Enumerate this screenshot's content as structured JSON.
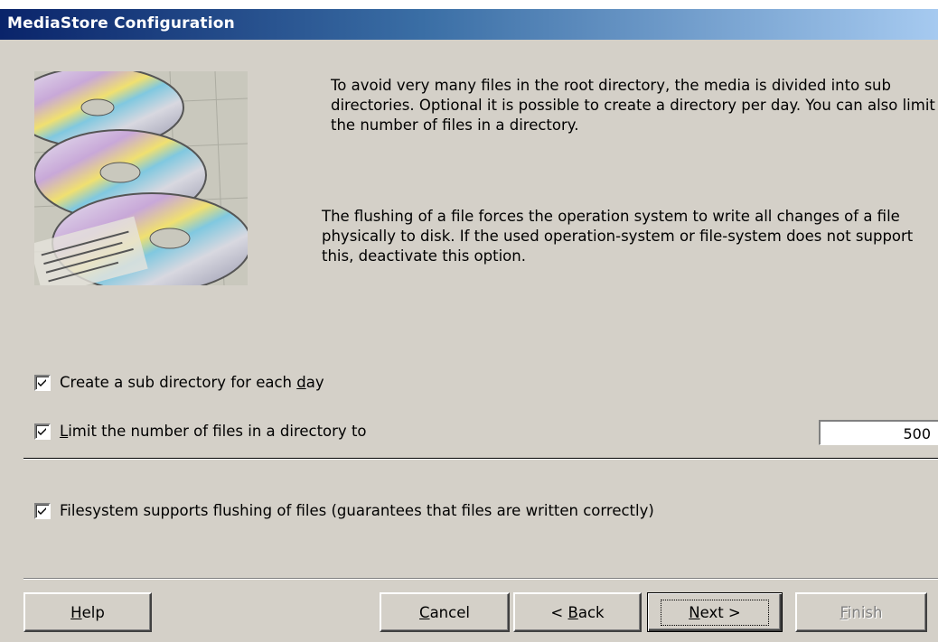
{
  "window": {
    "title": "MediaStore Configuration"
  },
  "image": {
    "icon": "cd-discs-illustration"
  },
  "description": {
    "line1": "To avoid very many files in the root directory, the media is divided into sub directories. Optional it is possible to create a directory per day. You can also limit the number of files in a directory.",
    "line2": "The flushing of a file forces the operation system to write all changes of a file physically to disk. If the used operation-system or file-system does not support this, deactivate this option."
  },
  "options": {
    "sub_directory": {
      "label_pre": "Create a sub directory for each ",
      "label_key": "d",
      "label_post": "ay",
      "checked": true
    },
    "limit_files": {
      "label_key": "L",
      "label_post": "imit the number of files in a directory to",
      "checked": true,
      "value": "500"
    },
    "flushing": {
      "label": "Filesystem supports flushing of files (guarantees that files are written correctly)",
      "checked": true
    }
  },
  "buttons": {
    "help": {
      "key": "H",
      "rest": "elp"
    },
    "cancel": {
      "key": "C",
      "rest": "ancel"
    },
    "back": {
      "pre": "< ",
      "key": "B",
      "rest": "ack"
    },
    "next": {
      "key": "N",
      "rest": "ext >"
    },
    "finish": {
      "key": "F",
      "rest": "inish"
    }
  }
}
